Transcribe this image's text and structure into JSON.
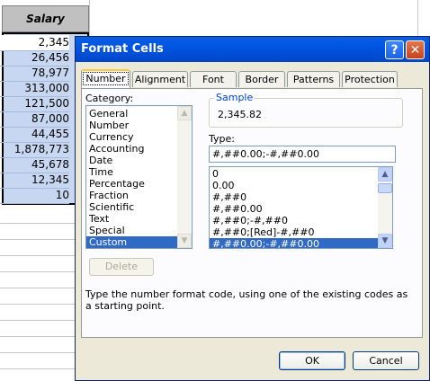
{
  "sheet": {
    "header": "Salary",
    "cells": [
      "2,345",
      "26,456",
      "78,977",
      "313,000",
      "121,500",
      "87,000",
      "44,455",
      "1,878,773",
      "45,678",
      "12,345",
      "10"
    ]
  },
  "dialog": {
    "title": "Format Cells",
    "help_glyph": "?",
    "close_glyph": "✕",
    "tabs": [
      "Number",
      "Alignment",
      "Font",
      "Border",
      "Patterns",
      "Protection"
    ],
    "active_tab": "Number",
    "category_label": "Category:",
    "categories": [
      "General",
      "Number",
      "Currency",
      "Accounting",
      "Date",
      "Time",
      "Percentage",
      "Fraction",
      "Scientific",
      "Text",
      "Special",
      "Custom"
    ],
    "selected_category": "Custom",
    "sample_label": "Sample",
    "sample_value": "2,345.82",
    "type_label": "Type:",
    "type_value": "#,##0.00;-#,##0.00",
    "type_list": [
      "0",
      "0.00",
      "#,##0",
      "#,##0.00",
      "#,##0;-#,##0",
      "#,##0;[Red]-#,##0",
      "#,##0.00;-#,##0.00"
    ],
    "selected_type": "#,##0.00;-#,##0.00",
    "delete_label": "Delete",
    "hint": "Type the number format code, using one of the existing codes as a starting point.",
    "ok_label": "OK",
    "cancel_label": "Cancel"
  },
  "colors": {
    "titlebar": "#0054e3",
    "selection": "#316ac5",
    "dialog_bg": "#ece9d8",
    "column_highlight": "#c7d6f1"
  }
}
